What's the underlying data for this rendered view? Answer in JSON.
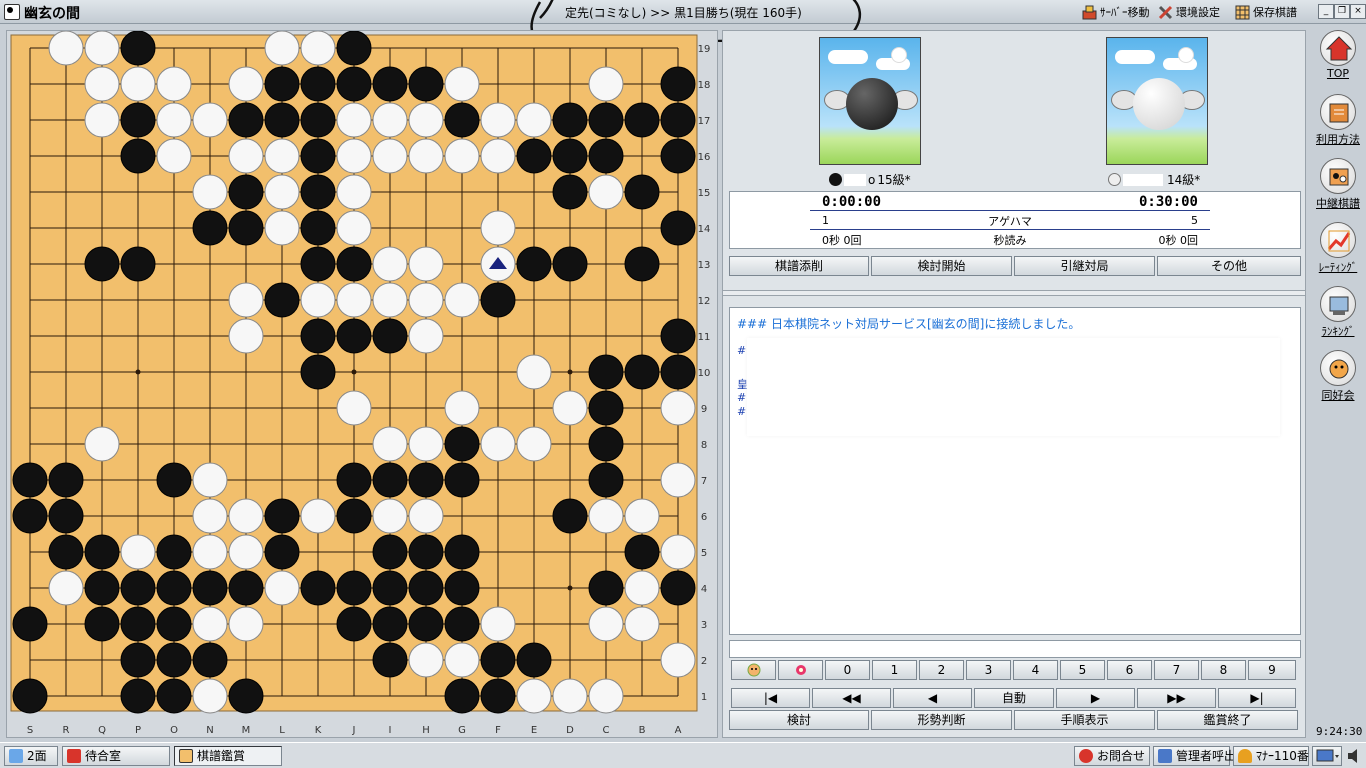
{
  "title_bar": {
    "app_title": "幽玄の間",
    "game_status": "定先(コミなし) >> 黒1目勝ち(現在 160手)",
    "menu": [
      {
        "label": "ｻｰﾊﾞｰ移動",
        "icon": "server-move-icon"
      },
      {
        "label": "環境設定",
        "icon": "settings-tools-icon"
      },
      {
        "label": "保存棋譜",
        "icon": "saved-records-icon"
      }
    ],
    "window_buttons": [
      "_",
      "❐",
      "×"
    ]
  },
  "board": {
    "size": 19,
    "columns": [
      "S",
      "R",
      "Q",
      "P",
      "O",
      "N",
      "M",
      "L",
      "K",
      "J",
      "I",
      "H",
      "G",
      "F",
      "E",
      "D",
      "C",
      "B",
      "A"
    ],
    "rows": [
      19,
      18,
      17,
      16,
      15,
      14,
      13,
      12,
      11,
      10,
      9,
      8,
      7,
      6,
      5,
      4,
      3,
      2,
      1
    ],
    "hoshi": [
      "P16",
      "P10",
      "P4",
      "J16",
      "J10",
      "J4",
      "D16",
      "D10",
      "D4"
    ],
    "last_move": "F13",
    "colors": {
      "wood": "#f2bf6c",
      "line": "#2b1a0a",
      "black": "#111111",
      "white": "#f7f7f7",
      "marker": "#1a237e"
    },
    "rows_layout": [
      ".wwb...wwb.........",
      "..www.wbbbbbw...w.b",
      "..wbwwbbbwwwbwwbbbb",
      "...bw.wwbwwwwwbbb.b",
      ".....wbwbw.....bwb.",
      ".....bbwbw...w....b",
      "..bb....bbww..bb.b.",
      "......wbwwwwwb.....",
      "......w.bbbw......b",
      "........b.....w.bbb",
      ".........w..w..wb.w",
      "..w.......wwbww.b..",
      "bb..bw...bbbb...b.w",
      "bb...wwbwbww...bww.",
      ".bbwbwwb..bbb....bw",
      ".wbbbbbwbbbbb...bwb",
      "b.bbbww..bbbbw..ww.",
      "...bbb....bwwbb...w",
      "b..bbwb.....bbwww.."
    ]
  },
  "players": {
    "black": {
      "name_visible": "o",
      "rank": "15級*",
      "color": "black"
    },
    "white": {
      "name_visible": "",
      "rank": "14級*",
      "color": "white"
    }
  },
  "clock": {
    "black_time": "0:00:00",
    "white_time": "0:30:00",
    "black_captures": "1",
    "captures_label": "アゲハマ",
    "white_captures": "5",
    "black_byoyomi": "0秒 0回",
    "byoyomi_label": "秒読み",
    "white_byoyomi": "0秒 0回"
  },
  "action_buttons": [
    "棋譜添削",
    "検討開始",
    "引継対局",
    "その他"
  ],
  "chat": {
    "lines": [
      "### 日本棋院ネット対局サービス[幽玄の間]に接続しました。",
      "##",
      "皇",
      "##",
      "##"
    ]
  },
  "number_buttons": [
    "0",
    "1",
    "2",
    "3",
    "4",
    "5",
    "6",
    "7",
    "8",
    "9"
  ],
  "nav_buttons": [
    "|◀",
    "◀◀",
    "◀",
    "自動",
    "▶",
    "▶▶",
    "▶|"
  ],
  "bottom_buttons": [
    "検討",
    "形勢判断",
    "手順表示",
    "鑑賞終了"
  ],
  "side_nav": [
    {
      "label": "TOP",
      "icon": "home-icon"
    },
    {
      "label": "利用方法",
      "icon": "book-icon"
    },
    {
      "label": "中継棋譜",
      "icon": "relay-icon"
    },
    {
      "label": "ﾚｰﾃｨﾝｸﾞ",
      "icon": "rating-icon"
    },
    {
      "label": "ﾗﾝｷﾝｸﾞ",
      "icon": "ranking-icon"
    },
    {
      "label": "同好会",
      "icon": "club-icon"
    }
  ],
  "clock_time": "9:24:30",
  "taskbar": {
    "left": [
      {
        "label": "2面",
        "icon": "screens-icon"
      },
      {
        "label": "待合室",
        "icon": "house-icon"
      },
      {
        "label": "棋譜鑑賞",
        "icon": "stones-icon",
        "active": true
      }
    ],
    "right": [
      {
        "label": "お問合せ",
        "icon": "phone-icon"
      },
      {
        "label": "管理者呼出",
        "icon": "admin-icon"
      },
      {
        "label": "ﾏﾅｰ110番",
        "icon": "siren-icon"
      }
    ]
  }
}
